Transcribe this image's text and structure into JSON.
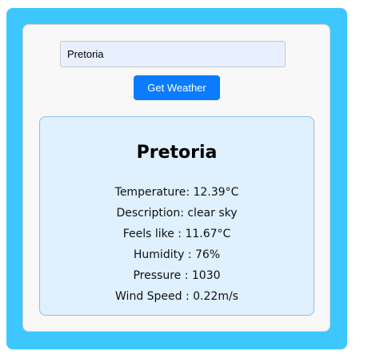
{
  "search": {
    "value": "Pretoria"
  },
  "button": {
    "label": "Get Weather"
  },
  "weather": {
    "city": "Pretoria",
    "temperature": "Temperature: 12.39°C",
    "description": "Description: clear sky",
    "feels_like": "Feels like : 11.67°C",
    "humidity": "Humidity : 76%",
    "pressure": "Pressure : 1030",
    "wind_speed": "Wind Speed : 0.22m/s"
  },
  "colors": {
    "frame": "#3ec7ff",
    "card": "#f8f8f8",
    "button": "#0a7cff",
    "result_panel": "#dff0ff",
    "result_border": "#8cc2ea"
  }
}
